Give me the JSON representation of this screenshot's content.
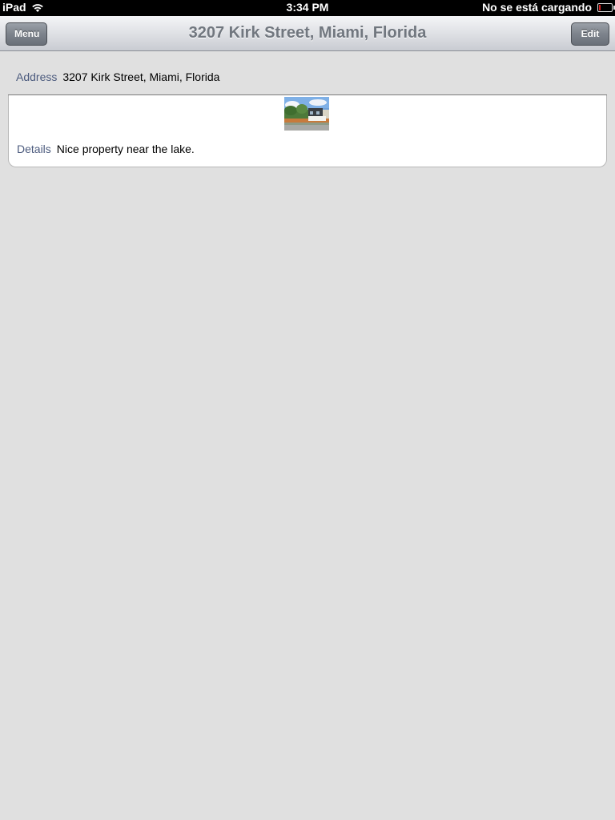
{
  "status_bar": {
    "device": "iPad",
    "time": "3:34 PM",
    "battery_status": "No se está cargando"
  },
  "nav": {
    "menu_label": "Menu",
    "title": "3207 Kirk Street, Miami, Florida",
    "edit_label": "Edit"
  },
  "property": {
    "address_label": "Address",
    "address_value": "3207 Kirk Street, Miami, Florida",
    "details_label": "Details",
    "details_value": "Nice property near the lake."
  },
  "icons": {
    "wifi": "wifi-icon",
    "battery": "battery-icon"
  },
  "colors": {
    "label": "#4c5b7e",
    "battery_low": "#e02020"
  }
}
